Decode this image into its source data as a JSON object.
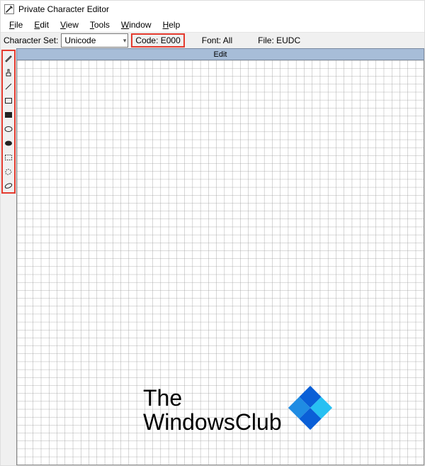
{
  "window": {
    "title": "Private Character Editor"
  },
  "menu": {
    "file": "File",
    "edit": "Edit",
    "view": "View",
    "tools": "Tools",
    "window": "Window",
    "help": "Help"
  },
  "info": {
    "charset_label": "Character Set:",
    "charset_value": "Unicode",
    "code": "Code: E000",
    "font": "Font: All",
    "file": "File: EUDC"
  },
  "canvas": {
    "header": "Edit"
  },
  "tools": {
    "pencil": "pencil",
    "brush": "brush",
    "line": "line",
    "rect_outline": "rect-outline",
    "rect_filled": "rect-filled",
    "ellipse_outline": "ellipse-outline",
    "ellipse_filled": "ellipse-filled",
    "select_rect": "select-rect",
    "select_free": "select-free",
    "eraser": "eraser"
  },
  "watermark": {
    "line1": "The",
    "line2": "WindowsClub"
  },
  "highlights": {
    "color": "#e43b2f"
  }
}
